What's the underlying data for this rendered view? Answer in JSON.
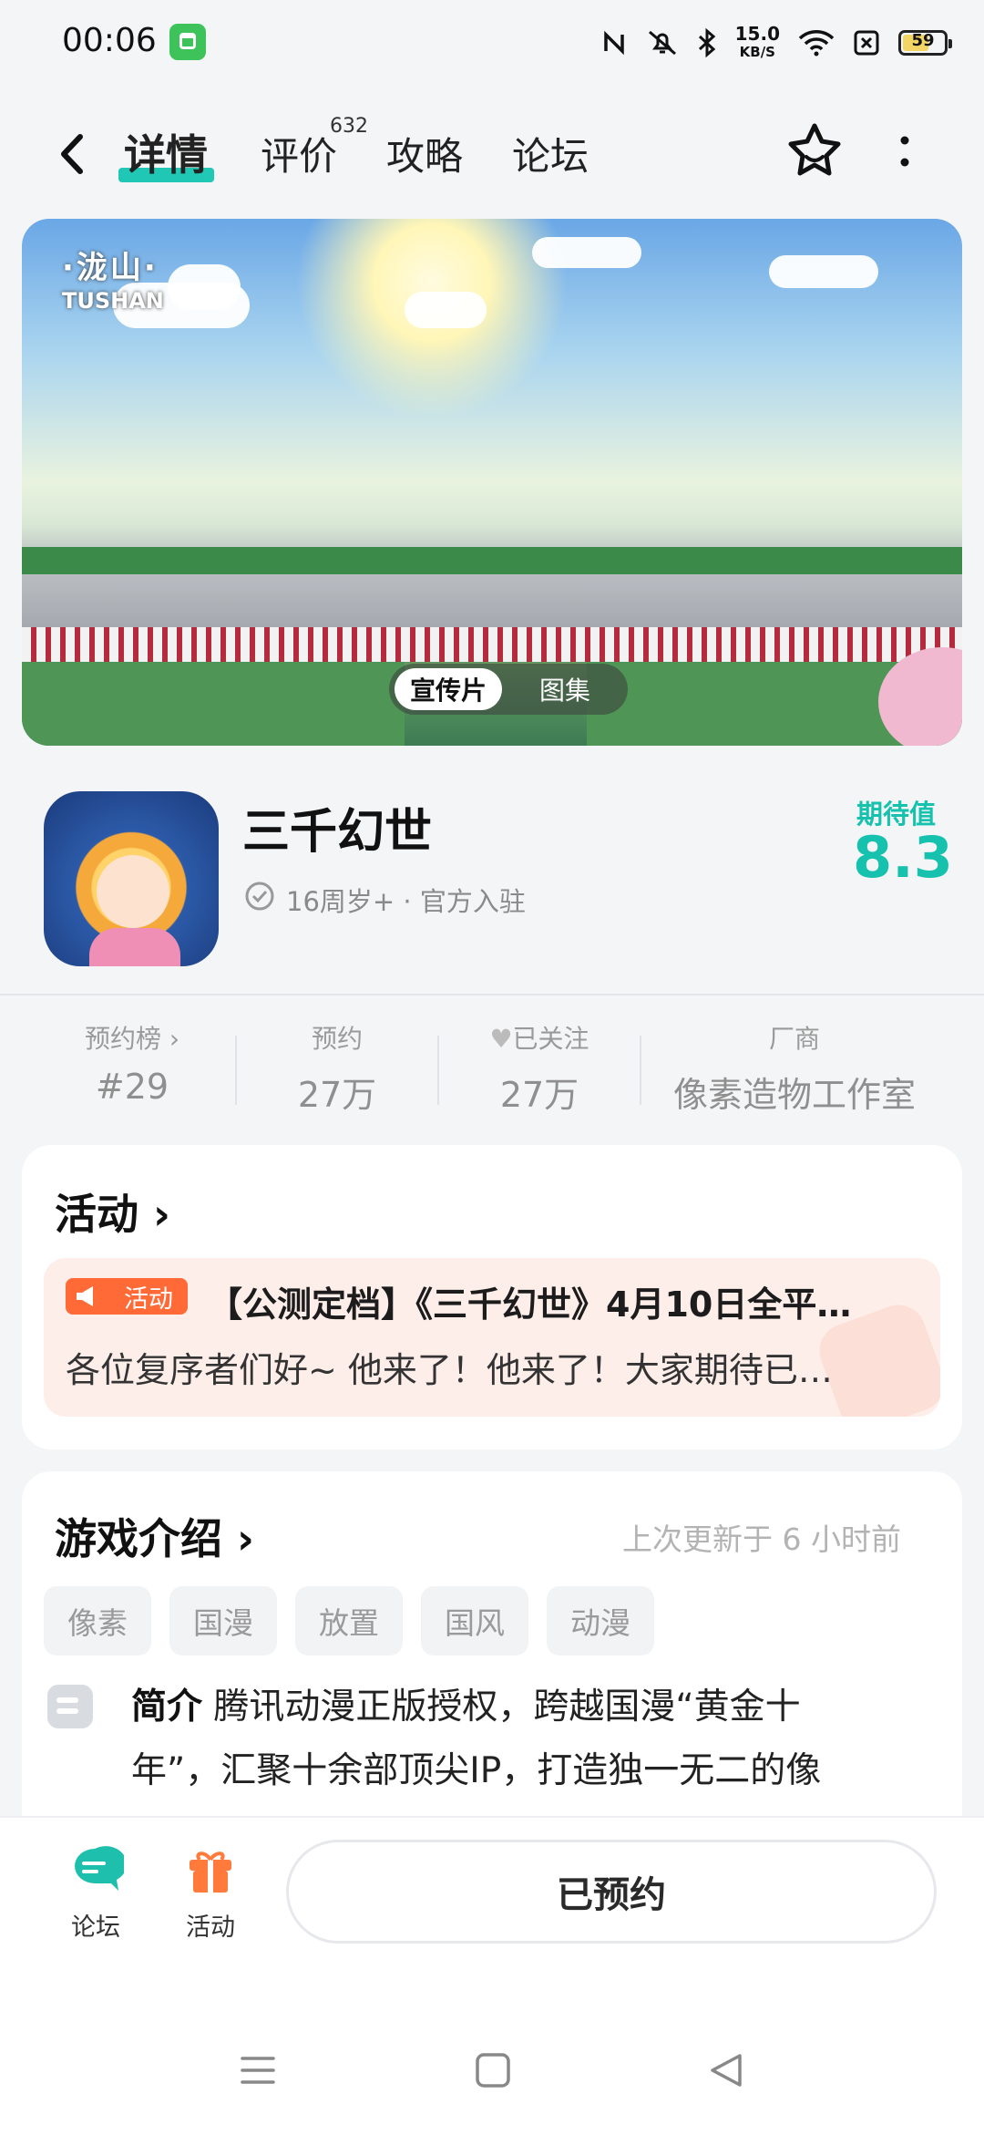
{
  "status_bar": {
    "time": "00:06",
    "net_speed_value": "15.0",
    "net_speed_unit": "KB/S",
    "battery": "59"
  },
  "header": {
    "tabs": [
      {
        "label": "详情",
        "active": true
      },
      {
        "label": "评价",
        "badge": "632"
      },
      {
        "label": "攻略"
      },
      {
        "label": "论坛"
      }
    ],
    "accent_color": "#1fc7b4"
  },
  "banner": {
    "logo_title": "·泷山·",
    "logo_subtitle": "TUSHAN",
    "segments": [
      "宣传片",
      "图集"
    ],
    "selected_segment": "宣传片"
  },
  "app": {
    "name": "三千幻世",
    "age_rating": "16周岁+",
    "official": "官方入驻",
    "expect_label": "期待值",
    "expect_score": "8.3"
  },
  "stats": [
    {
      "label": "预约榜",
      "value": "#29"
    },
    {
      "label": "预约",
      "value": "27万"
    },
    {
      "label": "已关注",
      "value": "27万"
    },
    {
      "label": "厂商",
      "value": "像素造物工作室"
    }
  ],
  "activity": {
    "title": "活动",
    "badge": "活动",
    "item_title": "【公测定档】《三千幻世》4月10日全平…",
    "item_body": "各位复序者们好~ 他来了！他来了！大家期待已…"
  },
  "intro": {
    "title": "游戏介绍",
    "update_note": "上次更新于 6 小时前",
    "tags": [
      "像素",
      "国漫",
      "放置",
      "国风",
      "动漫"
    ],
    "label": "简介",
    "text": "腾讯动漫正版授权，跨越国漫“黄金十年”，汇聚十余部顶尖IP，打造独一无二的像"
  },
  "bottom_bar": {
    "forum_label": "论坛",
    "activity_label": "活动",
    "reserve_label": "已预约"
  }
}
